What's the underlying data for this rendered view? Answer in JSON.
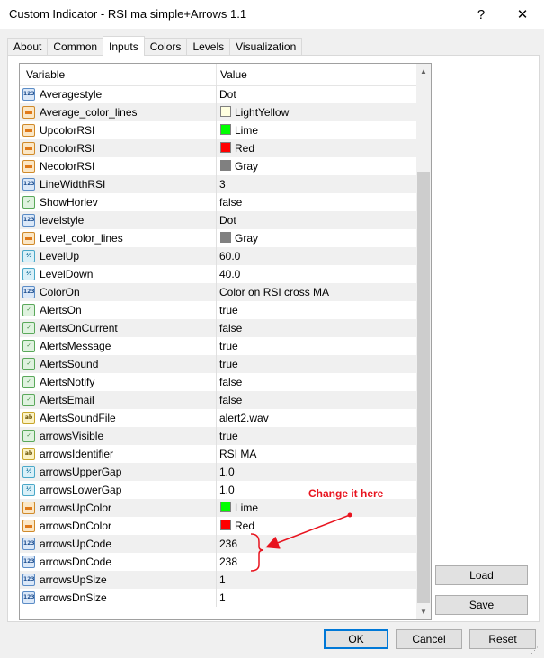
{
  "window": {
    "title": "Custom Indicator - RSI ma simple+Arrows 1.1",
    "help_label": "?",
    "close_label": "✕"
  },
  "tabs": [
    "About",
    "Common",
    "Inputs",
    "Colors",
    "Levels",
    "Visualization"
  ],
  "active_tab": "Inputs",
  "grid": {
    "headers": {
      "variable": "Variable",
      "value": "Value"
    },
    "rows": [
      {
        "type": "num",
        "name": "Averagestyle",
        "value": "Dot"
      },
      {
        "type": "col",
        "name": "Average_color_lines",
        "value": "LightYellow",
        "swatch": "#ffffe0"
      },
      {
        "type": "col",
        "name": "UpcolorRSI",
        "value": "Lime",
        "swatch": "#00ff00"
      },
      {
        "type": "col",
        "name": "DncolorRSI",
        "value": "Red",
        "swatch": "#ff0000"
      },
      {
        "type": "col",
        "name": "NecolorRSI",
        "value": "Gray",
        "swatch": "#808080"
      },
      {
        "type": "num",
        "name": "LineWidthRSI",
        "value": "3"
      },
      {
        "type": "bool",
        "name": "ShowHorlev",
        "value": "false"
      },
      {
        "type": "num",
        "name": "levelstyle",
        "value": "Dot"
      },
      {
        "type": "col",
        "name": "Level_color_lines",
        "value": "Gray",
        "swatch": "#808080"
      },
      {
        "type": "dbl",
        "name": "LevelUp",
        "value": "60.0"
      },
      {
        "type": "dbl",
        "name": "LevelDown",
        "value": "40.0"
      },
      {
        "type": "num",
        "name": "ColorOn",
        "value": "Color on RSI cross MA"
      },
      {
        "type": "bool",
        "name": "AlertsOn",
        "value": "true"
      },
      {
        "type": "bool",
        "name": "AlertsOnCurrent",
        "value": "false"
      },
      {
        "type": "bool",
        "name": "AlertsMessage",
        "value": "true"
      },
      {
        "type": "bool",
        "name": "AlertsSound",
        "value": "true"
      },
      {
        "type": "bool",
        "name": "AlertsNotify",
        "value": "false"
      },
      {
        "type": "bool",
        "name": "AlertsEmail",
        "value": "false"
      },
      {
        "type": "str",
        "name": "AlertsSoundFile",
        "value": "alert2.wav"
      },
      {
        "type": "bool",
        "name": "arrowsVisible",
        "value": "true"
      },
      {
        "type": "str",
        "name": "arrowsIdentifier",
        "value": " RSI MA"
      },
      {
        "type": "dbl",
        "name": "arrowsUpperGap",
        "value": "1.0"
      },
      {
        "type": "dbl",
        "name": "arrowsLowerGap",
        "value": "1.0"
      },
      {
        "type": "col",
        "name": "arrowsUpColor",
        "value": "Lime",
        "swatch": "#00ff00"
      },
      {
        "type": "col",
        "name": "arrowsDnColor",
        "value": "Red",
        "swatch": "#ff0000"
      },
      {
        "type": "num",
        "name": "arrowsUpCode",
        "value": "236"
      },
      {
        "type": "num",
        "name": "arrowsDnCode",
        "value": "238"
      },
      {
        "type": "num",
        "name": "arrowsUpSize",
        "value": "1"
      },
      {
        "type": "num",
        "name": "arrowsDnSize",
        "value": "1"
      }
    ]
  },
  "icon_glyphs": {
    "num": "123",
    "dbl": "½",
    "bool": "✓",
    "col": "",
    "str": "ab"
  },
  "buttons": {
    "load": "Load",
    "save": "Save",
    "ok": "OK",
    "cancel": "Cancel",
    "reset": "Reset"
  },
  "annotation": {
    "text": "Change it here",
    "color": "#e8141f"
  }
}
